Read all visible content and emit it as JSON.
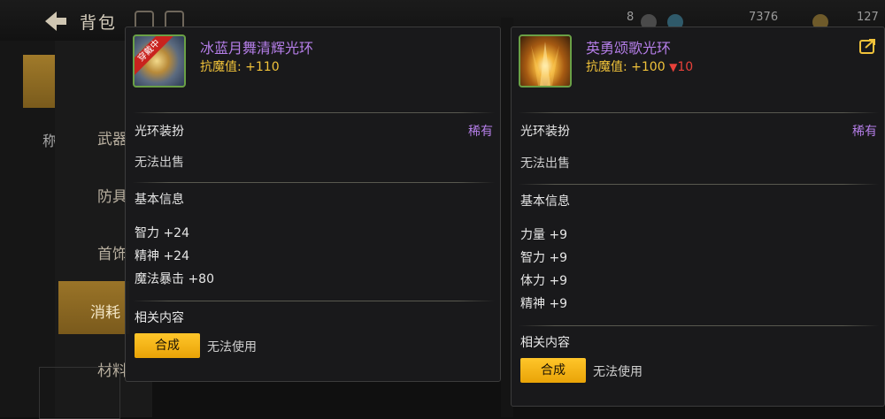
{
  "background": {
    "bag_title": "背包",
    "currency_1": "8",
    "currency_2": "7376",
    "currency_3": "127",
    "sidebar_label": "称",
    "categories": [
      "武器",
      "防具",
      "首饰",
      "消耗",
      "材料"
    ],
    "selected_category": "消耗"
  },
  "left_card": {
    "badge": "穿戴中",
    "name": "冰蓝月舞清辉光环",
    "stat_label": "抗魔值:",
    "stat_value": "+110",
    "type": "光环装扮",
    "rarity": "稀有",
    "sell": "无法出售",
    "info_title": "基本信息",
    "attributes": [
      {
        "name": "智力",
        "value": "+24"
      },
      {
        "name": "精神",
        "value": "+24"
      },
      {
        "name": "魔法暴击",
        "value": "+80"
      }
    ],
    "related_title": "相关内容",
    "action_label": "合成",
    "action_note": "无法使用"
  },
  "right_card": {
    "name": "英勇颂歌光环",
    "stat_label": "抗魔值:",
    "stat_value": "+100",
    "stat_diff_arrow": "▼",
    "stat_diff": "10",
    "type": "光环装扮",
    "rarity": "稀有",
    "sell": "无法出售",
    "info_title": "基本信息",
    "attributes": [
      {
        "name": "力量",
        "value": "+9"
      },
      {
        "name": "智力",
        "value": "+9"
      },
      {
        "name": "体力",
        "value": "+9"
      },
      {
        "name": "精神",
        "value": "+9"
      }
    ],
    "related_title": "相关内容",
    "action_label": "合成",
    "action_note": "无法使用"
  },
  "colors": {
    "item_name": "#b57ee8",
    "stat": "#f0c23a",
    "diff_down": "#e8413a",
    "button": "#ffc62a",
    "badge": "#c9231e"
  }
}
